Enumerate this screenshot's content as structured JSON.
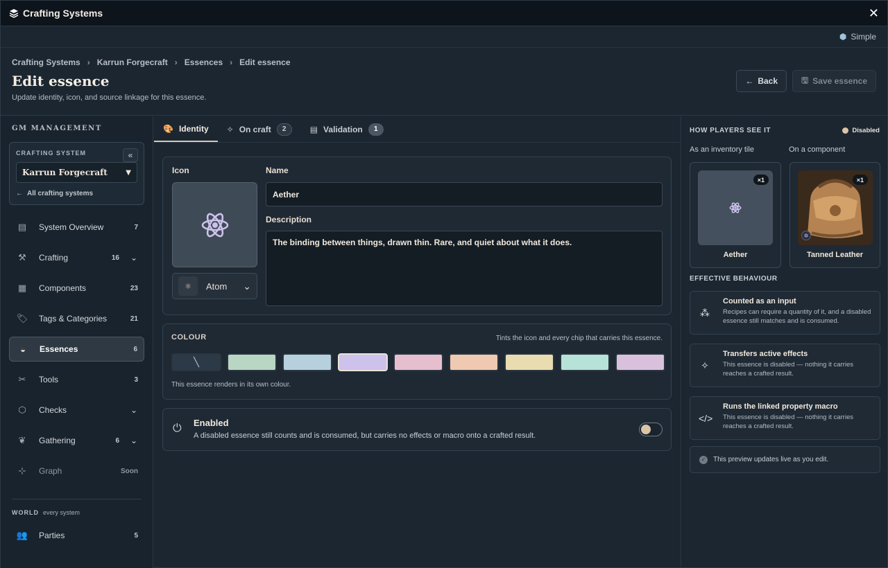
{
  "window": {
    "title": "Crafting Systems"
  },
  "modebar": {
    "mode_label": "Simple"
  },
  "breadcrumb": [
    "Crafting Systems",
    "Karrun Forgecraft",
    "Essences",
    "Edit essence"
  ],
  "page": {
    "title": "Edit essence",
    "subtitle": "Update identity, icon, and source linkage for this essence.",
    "back_label": "Back",
    "save_label": "Save essence"
  },
  "sidebar": {
    "section_title": "GM MANAGEMENT",
    "system_label": "CRAFTING SYSTEM",
    "system_value": "Karrun Forgecraft",
    "all_systems_label": "All crafting systems",
    "items": [
      {
        "label": "System Overview",
        "count": "7",
        "icon": "clipboard-icon"
      },
      {
        "label": "Crafting",
        "count": "16",
        "icon": "hammer-icon",
        "expandable": true
      },
      {
        "label": "Components",
        "count": "23",
        "icon": "boxes-icon"
      },
      {
        "label": "Tags & Categories",
        "count": "21",
        "icon": "tags-icon"
      },
      {
        "label": "Essences",
        "count": "6",
        "icon": "mortar-icon",
        "active": true
      },
      {
        "label": "Tools",
        "count": "3",
        "icon": "tools-icon"
      },
      {
        "label": "Checks",
        "count": "",
        "icon": "d20-icon",
        "expandable": true
      },
      {
        "label": "Gathering",
        "count": "6",
        "icon": "seedling-icon",
        "expandable": true
      },
      {
        "label": "Graph",
        "count": "Soon",
        "icon": "graph-icon"
      }
    ],
    "world_title": "WORLD",
    "world_sub": "every system",
    "world_items": [
      {
        "label": "Parties",
        "count": "5",
        "icon": "users-icon"
      }
    ]
  },
  "tabs": [
    {
      "label": "Identity",
      "badge": ""
    },
    {
      "label": "On craft",
      "badge": "2"
    },
    {
      "label": "Validation",
      "badge": "1"
    }
  ],
  "identity": {
    "icon_label": "Icon",
    "icon_select_value": "Atom",
    "name_label": "Name",
    "name_value": "Aether",
    "description_label": "Description",
    "description_value": "The binding between things, drawn thin. Rare, and quiet about what it does."
  },
  "colour": {
    "title": "COLOUR",
    "hint": "Tints the icon and every chip that carries this essence.",
    "note": "This essence renders in its own colour.",
    "swatches": [
      "none",
      "#b9d6c4",
      "#b7d0de",
      "#cdc2ec",
      "#e6bfcf",
      "#efc9b1",
      "#e8dcb0",
      "#b6e2d8",
      "#d9c1dd"
    ],
    "selected_index": 3
  },
  "enabled": {
    "title": "Enabled",
    "description": "A disabled essence still counts and is consumed, but carries no effects or macro onto a crafted result.",
    "value": false
  },
  "preview": {
    "title": "HOW PLAYERS SEE IT",
    "status": "Disabled",
    "inventory_label": "As an inventory tile",
    "component_label": "On a component",
    "inventory_tile": {
      "name": "Aether",
      "qty": "×1"
    },
    "component_tile": {
      "name": "Tanned Leather",
      "qty": "×1"
    },
    "behaviour_title": "EFFECTIVE BEHAVIOUR",
    "behaviours": [
      {
        "title": "Counted as an input",
        "desc": "Recipes can require a quantity of it, and a disabled essence still matches and is consumed.",
        "icon": "cubes-icon"
      },
      {
        "title": "Transfers active effects",
        "desc": "This essence is disabled — nothing it carries reaches a crafted result.",
        "icon": "magic-wand-icon"
      },
      {
        "title": "Runs the linked property macro",
        "desc": "This essence is disabled — nothing it carries reaches a crafted result.",
        "icon": "code-icon"
      }
    ],
    "note": "This preview updates live as you edit."
  },
  "colors": {
    "accent": "#cdc2ec",
    "bg": "#1b2631"
  }
}
